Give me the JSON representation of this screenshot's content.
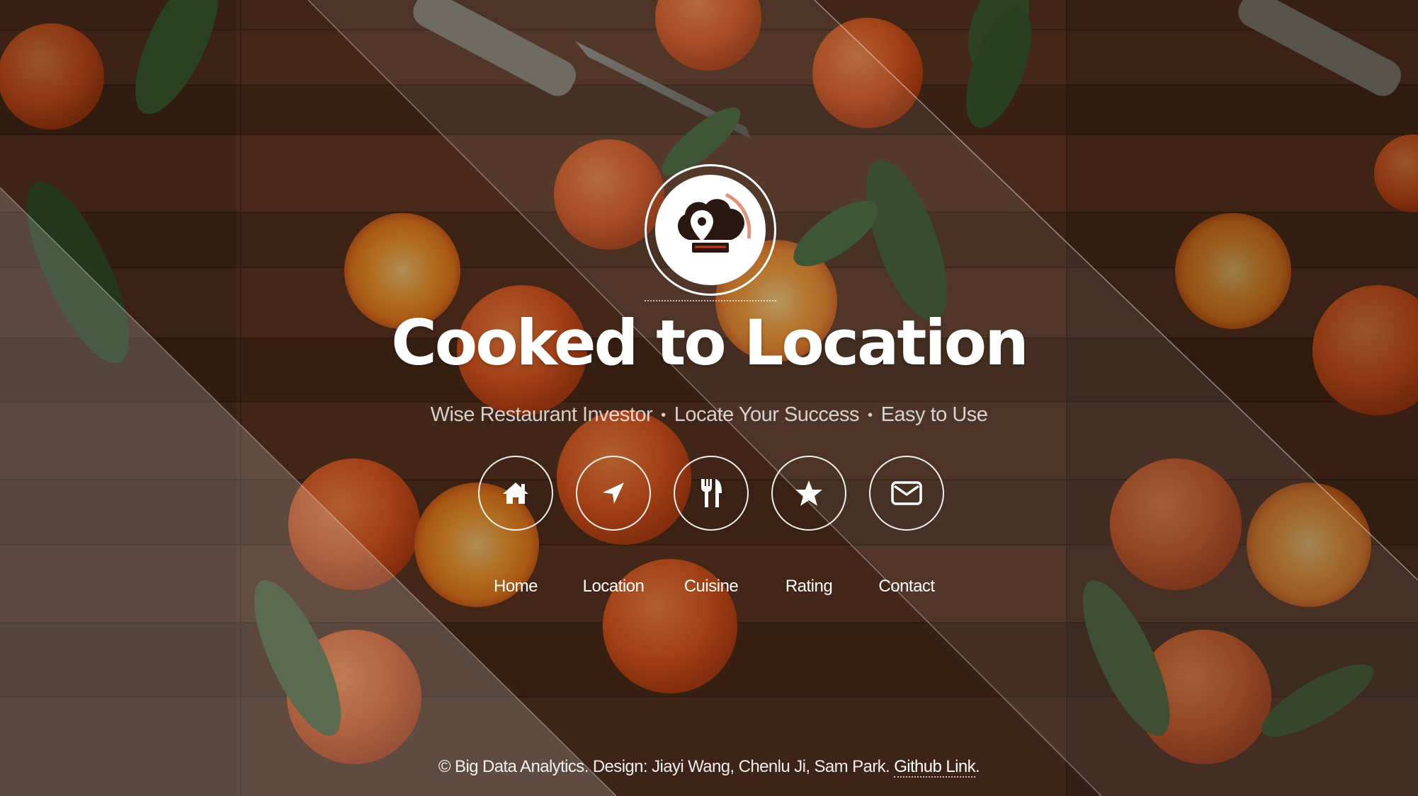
{
  "site": {
    "title": "Cooked to Location",
    "tagline": [
      "Wise Restaurant Investor",
      "Locate Your Success",
      "Easy to Use"
    ],
    "tagline_separator": "•"
  },
  "logo": {
    "icon": "chef-hat-location-pin-icon",
    "colors": {
      "ring": "#ffffff",
      "mark": "#2a1712",
      "accent": "#c53a14"
    }
  },
  "nav": {
    "items": [
      {
        "label": "Home",
        "icon": "home-icon"
      },
      {
        "label": "Location",
        "icon": "location-arrow-icon"
      },
      {
        "label": "Cuisine",
        "icon": "cutlery-icon"
      },
      {
        "label": "Rating",
        "icon": "star-icon"
      },
      {
        "label": "Contact",
        "icon": "envelope-icon"
      }
    ]
  },
  "footer": {
    "text": "© Big Data Analytics. Design: Jiayi Wang, Chenlu Ji, Sam Park.",
    "link_label": "Github Link",
    "trailing": "."
  },
  "background": {
    "description_colors": {
      "wood": "#4a2c1c",
      "orange": "#ec6a2c",
      "leaf": "#3b5a2a"
    }
  }
}
